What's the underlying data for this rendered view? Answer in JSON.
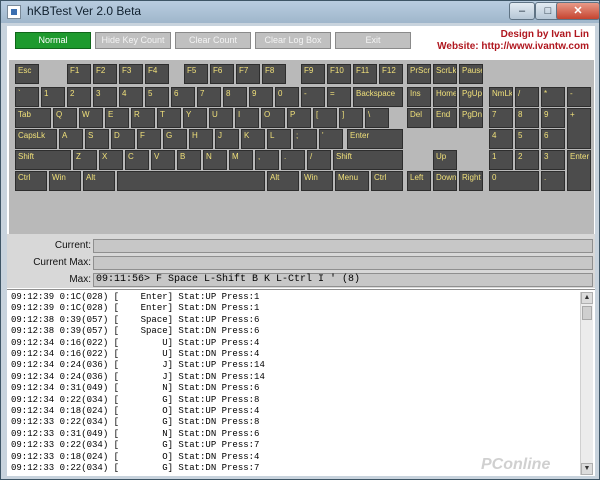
{
  "window": {
    "title": "hKBTest Ver 2.0 Beta",
    "minimize": "–",
    "maximize": "□",
    "close": "✕"
  },
  "toolbar": {
    "buttons": [
      "Normal",
      "Hide Key Count",
      "Clear Count",
      "Clear Log Box",
      "Exit"
    ],
    "active": 0,
    "credit_line1": "Design by Ivan Lin",
    "credit_line2": "Website: http://www.ivantw.com"
  },
  "keyboard": {
    "row_fn": [
      "Esc",
      "F1",
      "F2",
      "F3",
      "F4",
      "F5",
      "F6",
      "F7",
      "F8",
      "F9",
      "F10",
      "F11",
      "F12",
      "PrScr",
      "ScrLk",
      "Pause"
    ],
    "row_num": [
      "`",
      "1",
      "2",
      "3",
      "4",
      "5",
      "6",
      "7",
      "8",
      "9",
      "0",
      "-",
      "=",
      "Backspace",
      "Ins",
      "Home",
      "PgUp",
      "NmLk",
      "/",
      "*",
      "-"
    ],
    "row_tab": [
      "Tab",
      "Q",
      "W",
      "E",
      "R",
      "T",
      "Y",
      "U",
      "I",
      "O",
      "P",
      "[",
      "]",
      "\\",
      "Del",
      "End",
      "PgDn",
      "7",
      "8",
      "9",
      "+"
    ],
    "row_caps": [
      "CapsLk",
      "A",
      "S",
      "D",
      "F",
      "G",
      "H",
      "J",
      "K",
      "L",
      ";",
      "'",
      "Enter",
      "4",
      "5",
      "6"
    ],
    "row_shift": [
      "Shift",
      "Z",
      "X",
      "C",
      "V",
      "B",
      "N",
      "M",
      ",",
      ".",
      "/",
      "Shift",
      "Up",
      "1",
      "2",
      "3",
      "Enter"
    ],
    "row_ctrl": [
      "Ctrl",
      "Win",
      "Alt",
      "",
      "Alt",
      "Win",
      "Menu",
      "Ctrl",
      "Left",
      "Down",
      "Right",
      "0",
      "."
    ]
  },
  "info": {
    "current_label": "Current:",
    "current_value": "",
    "current_max_label": "Current Max:",
    "current_max_value": "",
    "max_label": "Max:",
    "max_value": "09:11:56> F Space L-Shift B K L-Ctrl I ' (8)"
  },
  "log": [
    "09:12:39 0:1C(028) [    Enter] Stat:UP Press:1",
    "09:12:39 0:1C(028) [    Enter] Stat:DN Press:1",
    "09:12:38 0:39(057) [    Space] Stat:UP Press:6",
    "09:12:38 0:39(057) [    Space] Stat:DN Press:6",
    "09:12:34 0:16(022) [        U] Stat:UP Press:4",
    "09:12:34 0:16(022) [        U] Stat:DN Press:4",
    "09:12:34 0:24(036) [        J] Stat:UP Press:14",
    "09:12:34 0:24(036) [        J] Stat:DN Press:14",
    "09:12:34 0:31(049) [        N] Stat:DN Press:6",
    "09:12:34 0:22(034) [        G] Stat:UP Press:8",
    "09:12:34 0:18(024) [        O] Stat:UP Press:4",
    "09:12:33 0:22(034) [        G] Stat:DN Press:8",
    "09:12:33 0:31(049) [        N] Stat:DN Press:6",
    "09:12:33 0:22(034) [        G] Stat:UP Press:7",
    "09:12:33 0:18(024) [        O] Stat:DN Press:4",
    "09:12:33 0:22(034) [        G] Stat:DN Press:7"
  ],
  "watermark": "PConline",
  "colors": {
    "accent_active": "#1e9a2e",
    "key_bg": "#4c4c4c",
    "key_label": "#f0e07a",
    "credit": "#b0171f"
  }
}
